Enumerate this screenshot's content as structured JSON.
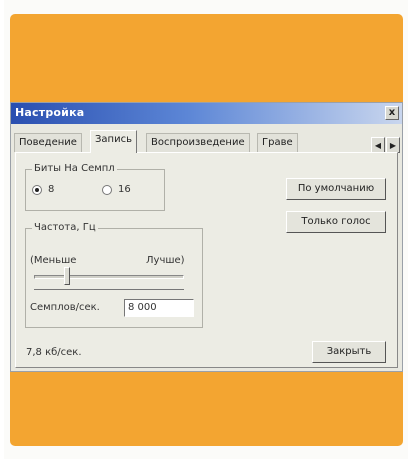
{
  "window": {
    "title": "Настройка",
    "close_label": "x"
  },
  "tabs": [
    {
      "label": "Поведение"
    },
    {
      "label": "Запись"
    },
    {
      "label": "Воспроизведение"
    },
    {
      "label": "Граве"
    }
  ],
  "tab_scroll": {
    "left": "◀",
    "right": "▶"
  },
  "bits_group": {
    "legend": "Биты На Семпл",
    "options": [
      {
        "label": "8",
        "selected": true
      },
      {
        "label": "16",
        "selected": false
      }
    ]
  },
  "frequency_group": {
    "legend": "Частота, Гц",
    "min_label": "(Меньше",
    "max_label": "Лучше)",
    "samples_label": "Семплов/сек.",
    "samples_value": "8 000"
  },
  "buttons": {
    "default": "По умолчанию",
    "voice_only": "Только голос",
    "close": "Закрыть"
  },
  "status": {
    "bitrate": "7,8 кб/сек."
  },
  "colors": {
    "accent_band": "#f3a531",
    "title_bar": "#2a4fb0",
    "dialog_bg": "#e8e8e0"
  }
}
